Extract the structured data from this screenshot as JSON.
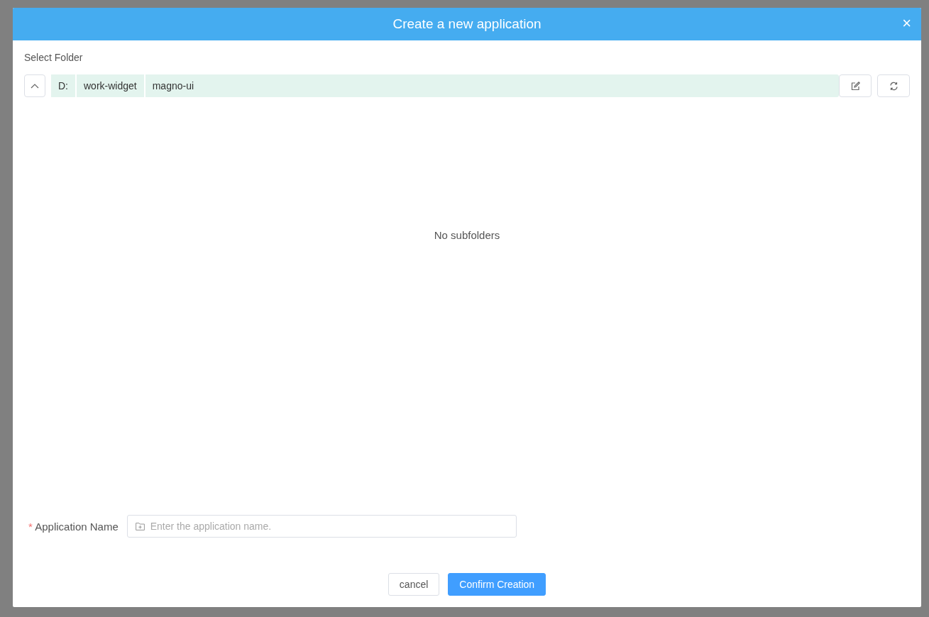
{
  "dialog": {
    "title": "Create a new application",
    "close_label": "×"
  },
  "folder": {
    "label": "Select Folder",
    "breadcrumbs": [
      "D:",
      "work-widget",
      "magno-ui"
    ],
    "empty_text": "No subfolders"
  },
  "form": {
    "required_mark": "*",
    "label": "Application Name",
    "placeholder": "Enter the application name."
  },
  "buttons": [
    {
      "label": "cancel",
      "kind": "default"
    },
    {
      "label": "Confirm Creation",
      "kind": "primary"
    }
  ]
}
